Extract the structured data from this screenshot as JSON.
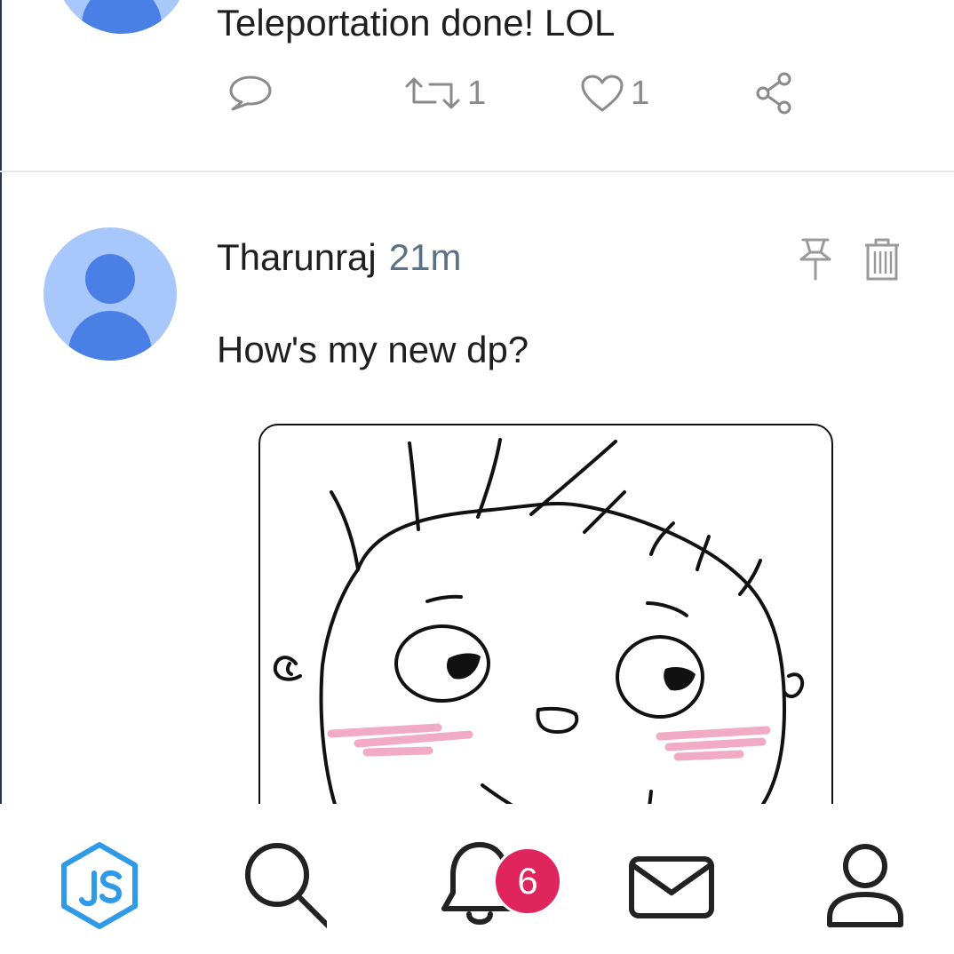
{
  "posts": [
    {
      "text": "Teleportation done! LOL",
      "actions": {
        "reply_icon": "comment-icon",
        "retweet_icon": "retweet-icon",
        "retweet_count": "1",
        "like_icon": "heart-icon",
        "like_count": "1",
        "share_icon": "share-icon"
      }
    },
    {
      "author": "Tharunraj",
      "time": "21m",
      "text": "How's my new dp?",
      "header_icons": [
        "pin-icon",
        "trash-icon"
      ],
      "image": "cartoon-face-drawing"
    }
  ],
  "bottom_nav": {
    "items": [
      "home-logo-icon",
      "search-icon",
      "notifications-icon",
      "messages-icon",
      "profile-icon"
    ],
    "notification_badge": "6",
    "colors": {
      "logo": "#2f9be8",
      "badge": "#e0245e",
      "icon": "#222222"
    }
  }
}
